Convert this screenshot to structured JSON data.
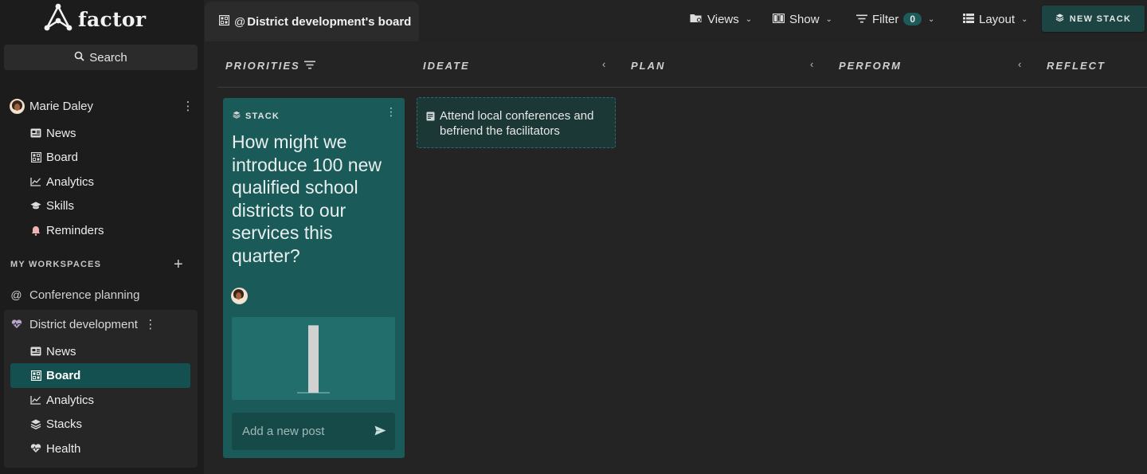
{
  "app": {
    "name": "factor"
  },
  "sidebar": {
    "search_label": "Search",
    "user": {
      "name": "Marie Daley"
    },
    "user_nav": [
      {
        "label": "News",
        "icon": "newspaper-icon"
      },
      {
        "label": "Board",
        "icon": "board-grid-icon"
      },
      {
        "label": "Analytics",
        "icon": "chart-line-icon"
      },
      {
        "label": "Skills",
        "icon": "graduation-cap-icon"
      },
      {
        "label": "Reminders",
        "icon": "bell-icon"
      }
    ],
    "workspaces_title": "MY WORKSPACES",
    "workspaces": [
      {
        "label": "Conference planning",
        "icon": "at-icon"
      },
      {
        "label": "District development",
        "icon": "heart-pulse-icon"
      }
    ],
    "workspace_nav": [
      {
        "label": "News",
        "icon": "newspaper-icon"
      },
      {
        "label": "Board",
        "icon": "board-grid-icon",
        "active": true
      },
      {
        "label": "Analytics",
        "icon": "chart-line-icon"
      },
      {
        "label": "Stacks",
        "icon": "layers-icon"
      },
      {
        "label": "Health",
        "icon": "heart-pulse-icon"
      }
    ]
  },
  "header": {
    "tab_title": "District development's board",
    "views_label": "Views",
    "show_label": "Show",
    "filter_label": "Filter",
    "filter_count": "0",
    "layout_label": "Layout",
    "new_stack_label": "NEW STACK"
  },
  "board": {
    "columns": [
      "PRIORITIES",
      "IDEATE",
      "PLAN",
      "PERFORM",
      "REFLECT"
    ],
    "stack": {
      "label": "STACK",
      "question": "How might we introduce 100 new qualified school districts to our services this quarter?",
      "add_post_placeholder": "Add a new post",
      "bar_level": 0.92
    },
    "post": {
      "text": "Attend local conferences and befriend the facilitators"
    }
  },
  "colors": {
    "accent": "#1a5a58",
    "accent_dark": "#14504f",
    "background": "#232323",
    "sidebar": "#1c1c1c"
  }
}
